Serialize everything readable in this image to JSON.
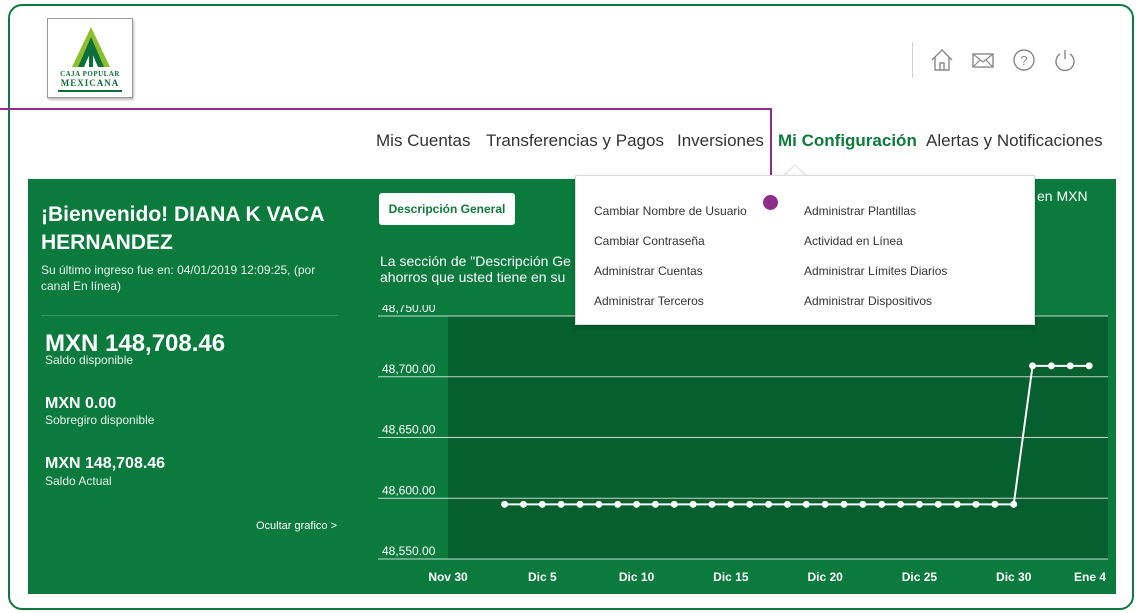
{
  "brand": {
    "logo_line1": "CAJA POPULAR",
    "logo_line2": "MEXICANA",
    "colors": {
      "primary": "#0a7a3d",
      "accent": "#8e2d8a",
      "plot": "#055f2e"
    }
  },
  "top_icons": [
    "home-icon",
    "mail-icon",
    "help-icon",
    "power-icon"
  ],
  "nav": {
    "mis_cuentas": "Mis Cuentas",
    "transferencias": "Transferencias y Pagos",
    "inversiones": "Inversiones",
    "mi_configuracion": "Mi Configuración",
    "alertas": "Alertas y Notificaciones",
    "active": "Mi Configuración"
  },
  "dropdown": {
    "left": [
      "Cambiar Nombre de Usuario",
      "Cambiar Contraseña",
      "Administrar Cuentas",
      "Administrar Terceros"
    ],
    "right": [
      "Administrar Plantillas",
      "Actividad en Línea",
      "Administrar Límites Diarios",
      "Administrar Dispositivos"
    ]
  },
  "account": {
    "welcome": "¡Bienvenido! DIANA K VACA HERNANDEZ",
    "last_login": "Su último ingreso fue en: 04/01/2019 12:09:25, (por canal En línea)",
    "saldo_disponible": "MXN 148,708.46",
    "saldo_disponible_label": "Saldo disponible",
    "sobregiro": "MXN 0.00",
    "sobregiro_label": "Sobregiro disponible",
    "saldo_actual": "MXN 148,708.46",
    "saldo_actual_label": "Saldo Actual",
    "hide_chart": "Ocultar grafico >"
  },
  "main": {
    "desc_button": "Descripción General",
    "desc_line1": "La sección de \"Descripción Ge",
    "desc_line2": "ahorros que usted tiene en su",
    "currency_text": "en  MXN"
  },
  "chart_data": {
    "type": "line",
    "title": "",
    "xlabel": "",
    "ylabel": "",
    "x_ticks": [
      "Nov 30",
      "Dic 5",
      "Dic 10",
      "Dic 15",
      "Dic 20",
      "Dic 25",
      "Dic 30",
      "Ene 4"
    ],
    "y_ticks": [
      "48,550.00",
      "48,600.00",
      "48,650.00",
      "48,700.00",
      "48,750.00"
    ],
    "ylim": [
      48550,
      48750
    ],
    "xlim": [
      0,
      35
    ],
    "grid": true,
    "series": [
      {
        "x": [
          3,
          4,
          5,
          6,
          7,
          8,
          9,
          10,
          11,
          12,
          13,
          14,
          15,
          16,
          17,
          18,
          19,
          20,
          21,
          22,
          23,
          24,
          25,
          26,
          27,
          28,
          29,
          30,
          31,
          32,
          33,
          34
        ],
        "values": [
          48595,
          48595,
          48595,
          48595,
          48595,
          48595,
          48595,
          48595,
          48595,
          48595,
          48595,
          48595,
          48595,
          48595,
          48595,
          48595,
          48595,
          48595,
          48595,
          48595,
          48595,
          48595,
          48595,
          48595,
          48595,
          48595,
          48595,
          48595,
          48709,
          48709,
          48709,
          48709
        ]
      }
    ]
  }
}
